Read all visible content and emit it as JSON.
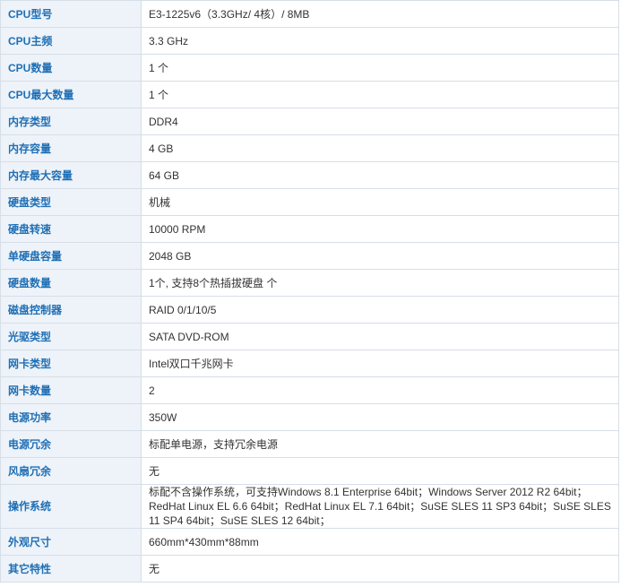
{
  "rows": [
    {
      "label": "CPU型号",
      "value": "E3-1225v6（3.3GHz/ 4核）/ 8MB"
    },
    {
      "label": "CPU主频",
      "value": "3.3  GHz"
    },
    {
      "label": "CPU数量",
      "value": "1  个"
    },
    {
      "label": "CPU最大数量",
      "value": "1  个"
    },
    {
      "label": "内存类型",
      "value": "DDR4"
    },
    {
      "label": "内存容量",
      "value": "4  GB"
    },
    {
      "label": "内存最大容量",
      "value": "64  GB"
    },
    {
      "label": "硬盘类型",
      "value": "机械"
    },
    {
      "label": "硬盘转速",
      "value": "10000 RPM"
    },
    {
      "label": "单硬盘容量",
      "value": "2048  GB"
    },
    {
      "label": "硬盘数量",
      "value": "1个, 支持8个热插拔硬盘  个"
    },
    {
      "label": "磁盘控制器",
      "value": "RAID 0/1/10/5"
    },
    {
      "label": "光驱类型",
      "value": "SATA DVD-ROM"
    },
    {
      "label": "网卡类型",
      "value": "Intel双口千兆网卡"
    },
    {
      "label": "网卡数量",
      "value": "2"
    },
    {
      "label": "电源功率",
      "value": "350W"
    },
    {
      "label": "电源冗余",
      "value": "标配单电源，支持冗余电源"
    },
    {
      "label": "风扇冗余",
      "value": "无"
    },
    {
      "label": "操作系统",
      "value": "标配不含操作系统，可支持Windows 8.1 Enterprise 64bit；Windows Server 2012 R2 64bit；RedHat Linux EL 6.6 64bit；RedHat Linux EL 7.1 64bit；SuSE SLES 11 SP3 64bit；SuSE SLES 11 SP4 64bit；SuSE SLES 12 64bit；"
    },
    {
      "label": "外观尺寸",
      "value": "660mm*430mm*88mm"
    },
    {
      "label": "其它特性",
      "value": "无"
    }
  ]
}
